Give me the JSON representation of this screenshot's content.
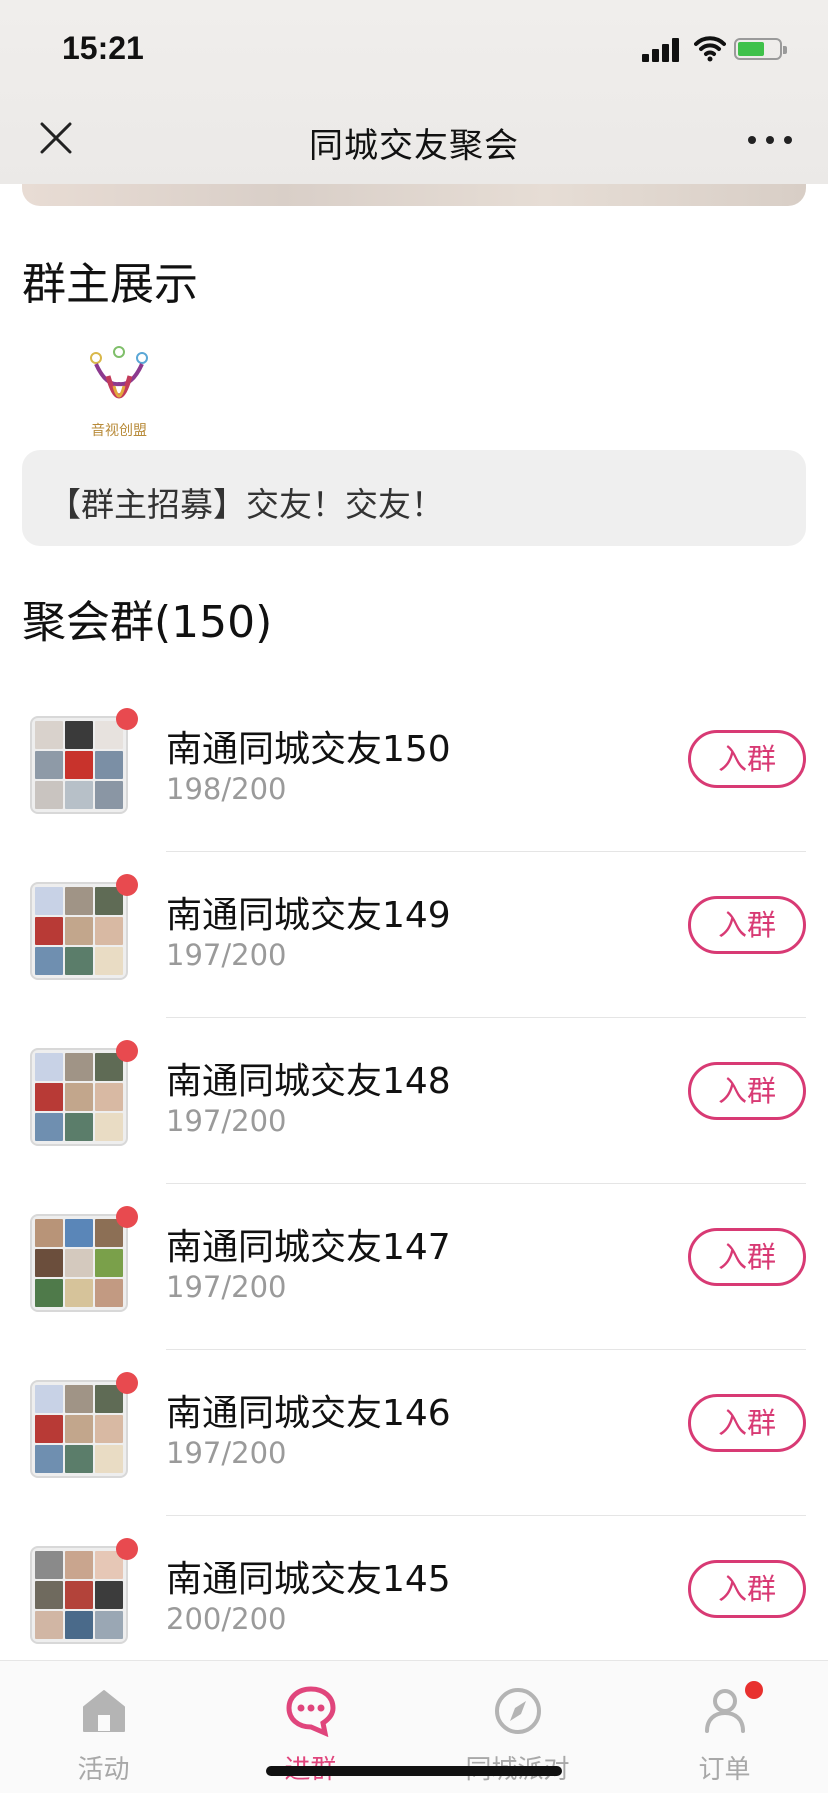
{
  "status_bar": {
    "time": "15:21"
  },
  "nav": {
    "title": "同城交友聚会"
  },
  "owner_section": {
    "title": "群主展示",
    "logo_text": "音视创盟",
    "notice": "【群主招募】交友！交友！"
  },
  "groups_section": {
    "title": "聚会群(150)",
    "join_label": "入群",
    "items": [
      {
        "name": "南通同城交友150",
        "count": "198/200"
      },
      {
        "name": "南通同城交友149",
        "count": "197/200"
      },
      {
        "name": "南通同城交友148",
        "count": "197/200"
      },
      {
        "name": "南通同城交友147",
        "count": "197/200"
      },
      {
        "name": "南通同城交友146",
        "count": "197/200"
      },
      {
        "name": "南通同城交友145",
        "count": "200/200"
      }
    ]
  },
  "tabbar": {
    "items": [
      {
        "label": "活动",
        "icon": "home-icon"
      },
      {
        "label": "进群",
        "icon": "chat-bubble-icon"
      },
      {
        "label": "同城派对",
        "icon": "compass-icon"
      },
      {
        "label": "订单",
        "icon": "person-icon"
      }
    ],
    "active": "进群"
  },
  "colors": {
    "accent": "#d83a74",
    "badge": "#e84a4f",
    "muted": "#9a9a9a"
  }
}
